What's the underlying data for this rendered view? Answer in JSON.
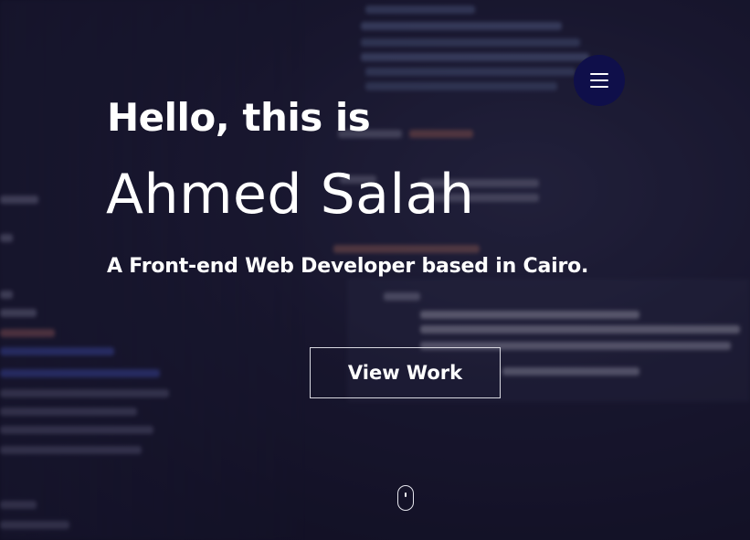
{
  "hero": {
    "greeting": "Hello, this is",
    "name": "Ahmed Salah",
    "tagline": "A Front-end Web Developer based in Cairo.",
    "cta_label": "View Work"
  },
  "nav": {
    "menu_icon": "hamburger-menu-icon"
  },
  "scroll": {
    "icon": "mouse-scroll-icon"
  },
  "colors": {
    "background": "#1c1b33",
    "menu_button": "#0f0f4a",
    "text": "#ffffff",
    "button_border": "#d8d8e0"
  }
}
